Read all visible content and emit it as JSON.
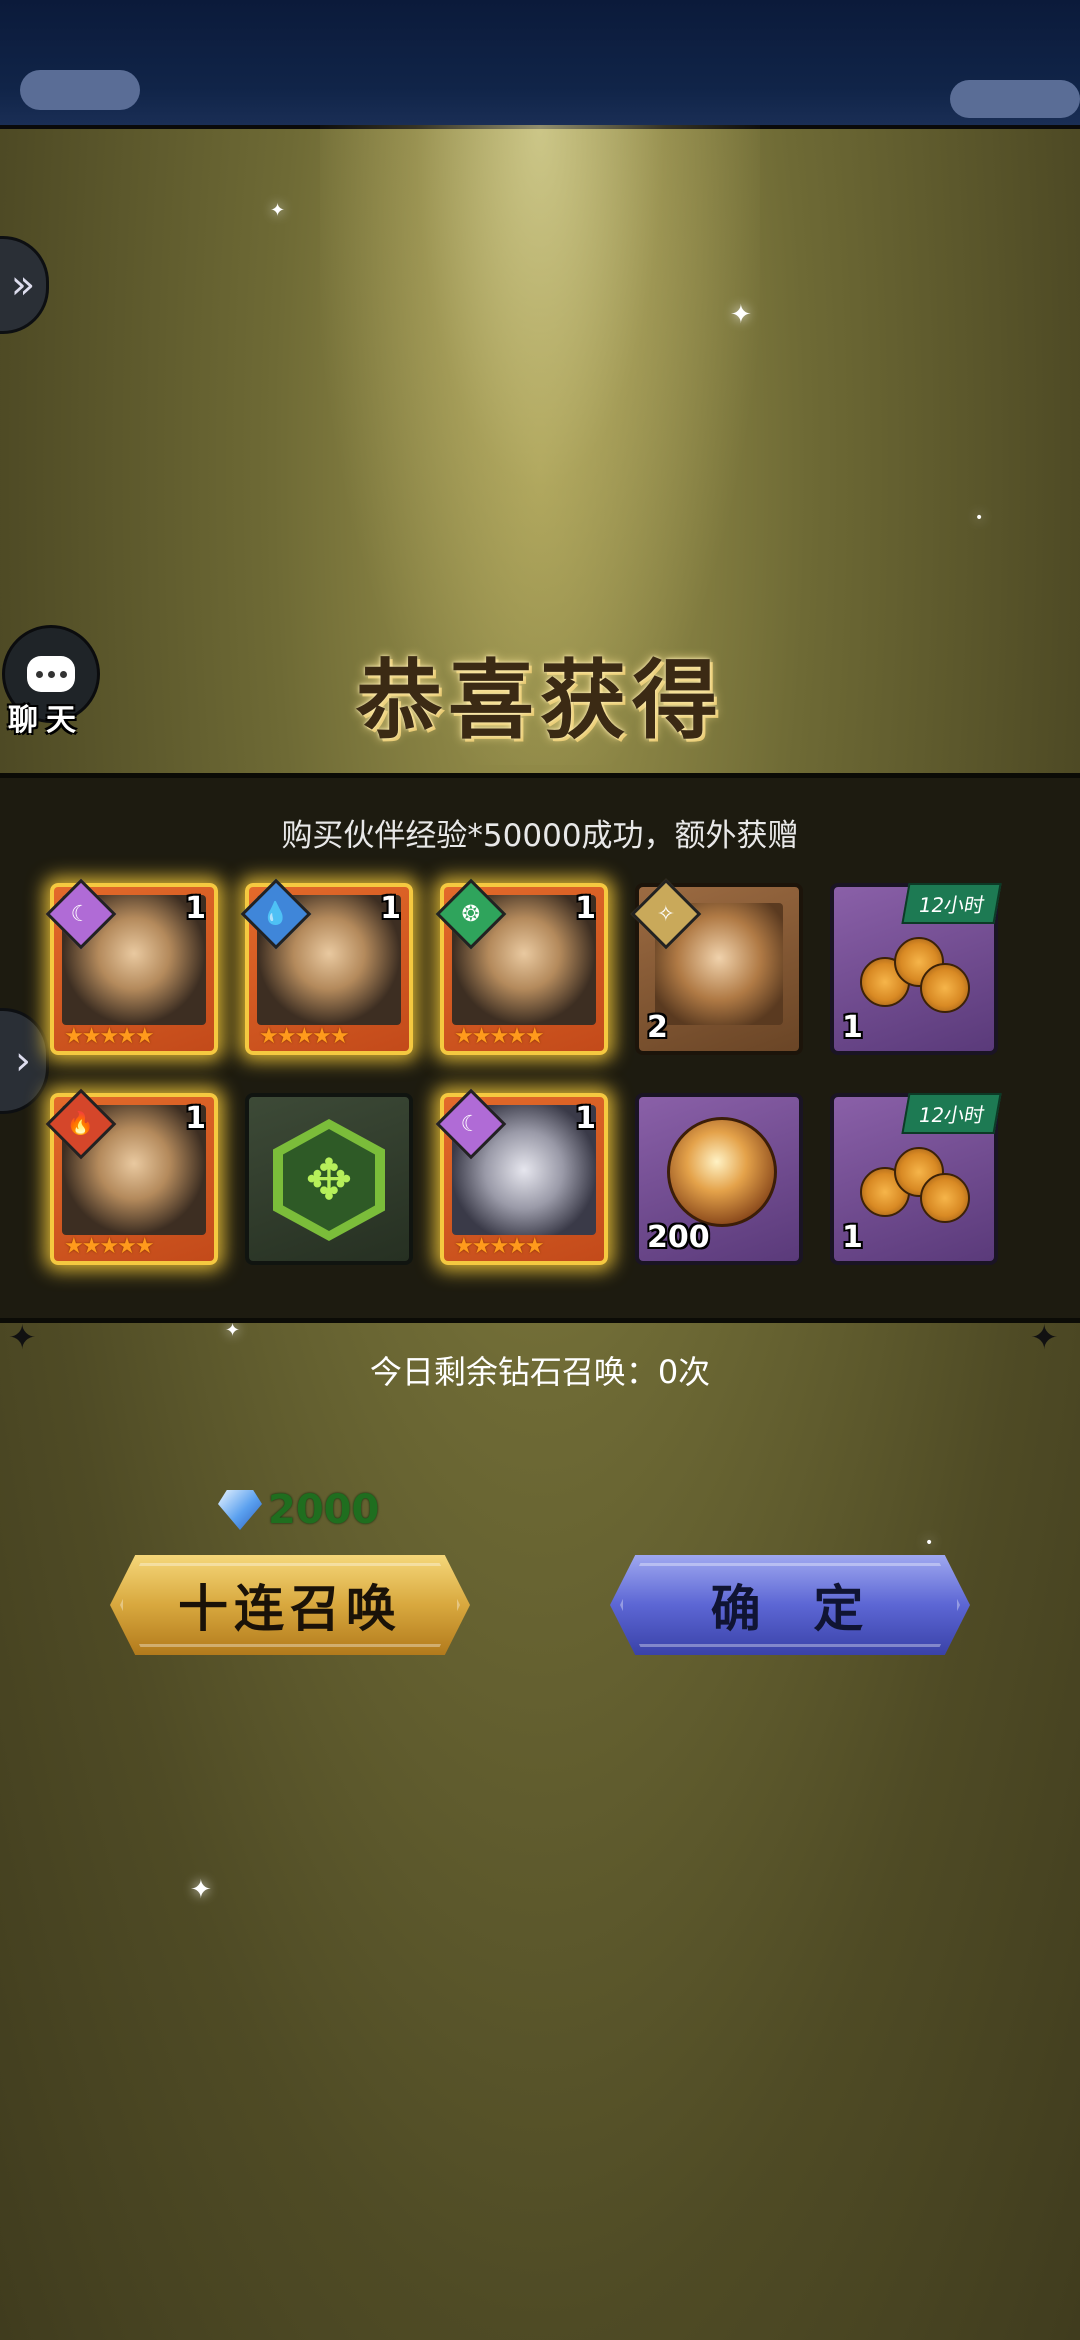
{
  "title": "恭喜获得",
  "purchase_message": "购买伙伴经验*50000成功，额外获赠",
  "chat_label": "聊天",
  "remaining_text": "今日剩余钻石召唤：0次",
  "cost": {
    "icon": "diamond-icon",
    "amount": "2000"
  },
  "buttons": {
    "summon_ten": "十连召唤",
    "confirm": "确  定"
  },
  "rewards": [
    {
      "kind": "hero",
      "element": "moon-element-icon",
      "element_color": "#b06bd6",
      "count": "1",
      "stars": "★★★★★"
    },
    {
      "kind": "hero",
      "element": "water-element-icon",
      "element_color": "#3f86d9",
      "count": "1",
      "stars": "★★★★★"
    },
    {
      "kind": "hero",
      "element": "wind-element-icon",
      "element_color": "#2fa45c",
      "count": "1",
      "stars": "★★★★★"
    },
    {
      "kind": "fragment",
      "element": "light-element-icon",
      "element_color": "#c9a95a",
      "count": "2"
    },
    {
      "kind": "rose-chest",
      "ribbon": "12小时",
      "count": "1"
    },
    {
      "kind": "hero",
      "element": "fire-element-icon",
      "element_color": "#d5462a",
      "count": "1",
      "stars": "★★★★★"
    },
    {
      "kind": "emblem",
      "icon": "green-hex-emblem-icon"
    },
    {
      "kind": "hero",
      "element": "moon-element-icon",
      "element_color": "#b06bd6",
      "count": "1",
      "stars": "★★★★★"
    },
    {
      "kind": "orb",
      "icon": "golden-orb-icon",
      "count": "200"
    },
    {
      "kind": "rose-chest",
      "ribbon": "12小时",
      "count": "1"
    }
  ],
  "colors": {
    "hero_frame": "#f5c940",
    "gold_button": "#d8a83e",
    "blue_button": "#5c66d4",
    "cost_text": "#1f6e1f"
  }
}
